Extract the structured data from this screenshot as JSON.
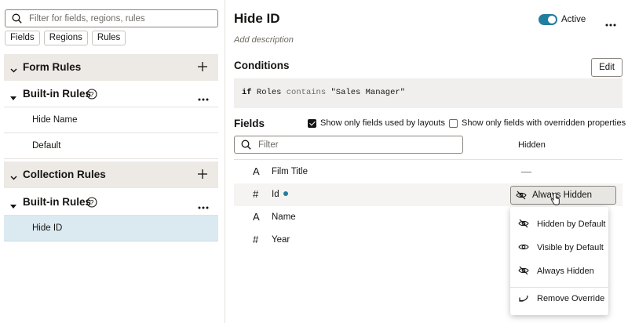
{
  "left": {
    "search_placeholder": "Filter for fields, regions, rules",
    "chips": [
      "Fields",
      "Regions",
      "Rules"
    ],
    "form_rules": {
      "title": "Form Rules",
      "builtin_title": "Built-in Rules",
      "items": [
        "Hide Name",
        "Default"
      ]
    },
    "collection_rules": {
      "title": "Collection Rules",
      "builtin_title": "Built-in Rules",
      "items": [
        "Hide ID"
      ]
    }
  },
  "header": {
    "title": "Hide ID",
    "active_label": "Active",
    "active": true,
    "description_placeholder": "Add description"
  },
  "conditions": {
    "label": "Conditions",
    "edit_label": "Edit",
    "kw_if": "if",
    "field": "Roles",
    "operator": "contains",
    "value": "\"Sales Manager\""
  },
  "fields": {
    "label": "Fields",
    "checkbox_used_by_layouts": "Show only fields used by layouts",
    "checkbox_used_checked": true,
    "checkbox_overridden": "Show only fields with overridden properties",
    "checkbox_overridden_checked": false,
    "filter_placeholder": "Filter",
    "col_hidden": "Hidden",
    "rows": [
      {
        "type_symbol": "A",
        "name": "Film Title",
        "hidden": "—"
      },
      {
        "type_symbol": "#",
        "name": "Id",
        "hidden": "Always Hidden"
      },
      {
        "type_symbol": "A",
        "name": "Name",
        "hidden": ""
      },
      {
        "type_symbol": "#",
        "name": "Year",
        "hidden": ""
      }
    ]
  },
  "hidden_menu": {
    "items": [
      {
        "label": "Hidden by Default",
        "icon": "eye-slash-icon"
      },
      {
        "label": "Visible by Default",
        "icon": "eye-icon"
      },
      {
        "label": "Always Hidden",
        "icon": "eye-slash-icon"
      },
      {
        "label": "Remove Override",
        "icon": "undo-icon"
      }
    ]
  },
  "colors": {
    "accent": "#227e9e",
    "selected_row": "#dbe9f1",
    "section_header": "#ede9e5"
  }
}
